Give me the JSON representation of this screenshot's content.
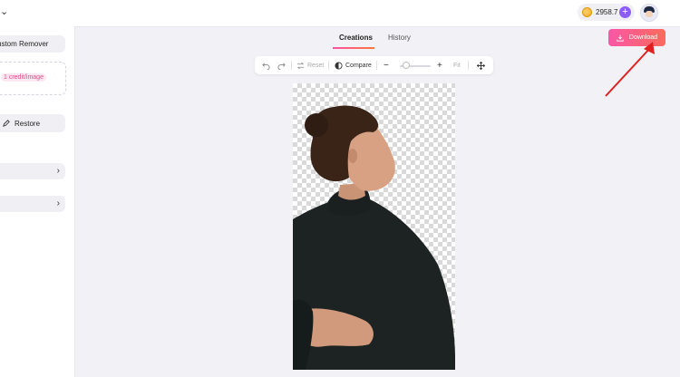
{
  "header": {
    "credits": "2958.7",
    "plus_label": "+"
  },
  "left_panel": {
    "custom_remover_label": "ustom Remover",
    "credit_chip": "1 credit/image",
    "restore_label": "Restore"
  },
  "tabs": [
    {
      "label": "Creations",
      "active": true
    },
    {
      "label": "History",
      "active": false
    }
  ],
  "download_label": "Download",
  "toolbar": {
    "reset_label": "Reset",
    "compare_label": "Compare",
    "fit_label": "Fit",
    "zoom_level": 0.2
  },
  "colors": {
    "accent_start": "#f857a6",
    "accent_end": "#ff6a5c",
    "annotation": "#e02020"
  }
}
